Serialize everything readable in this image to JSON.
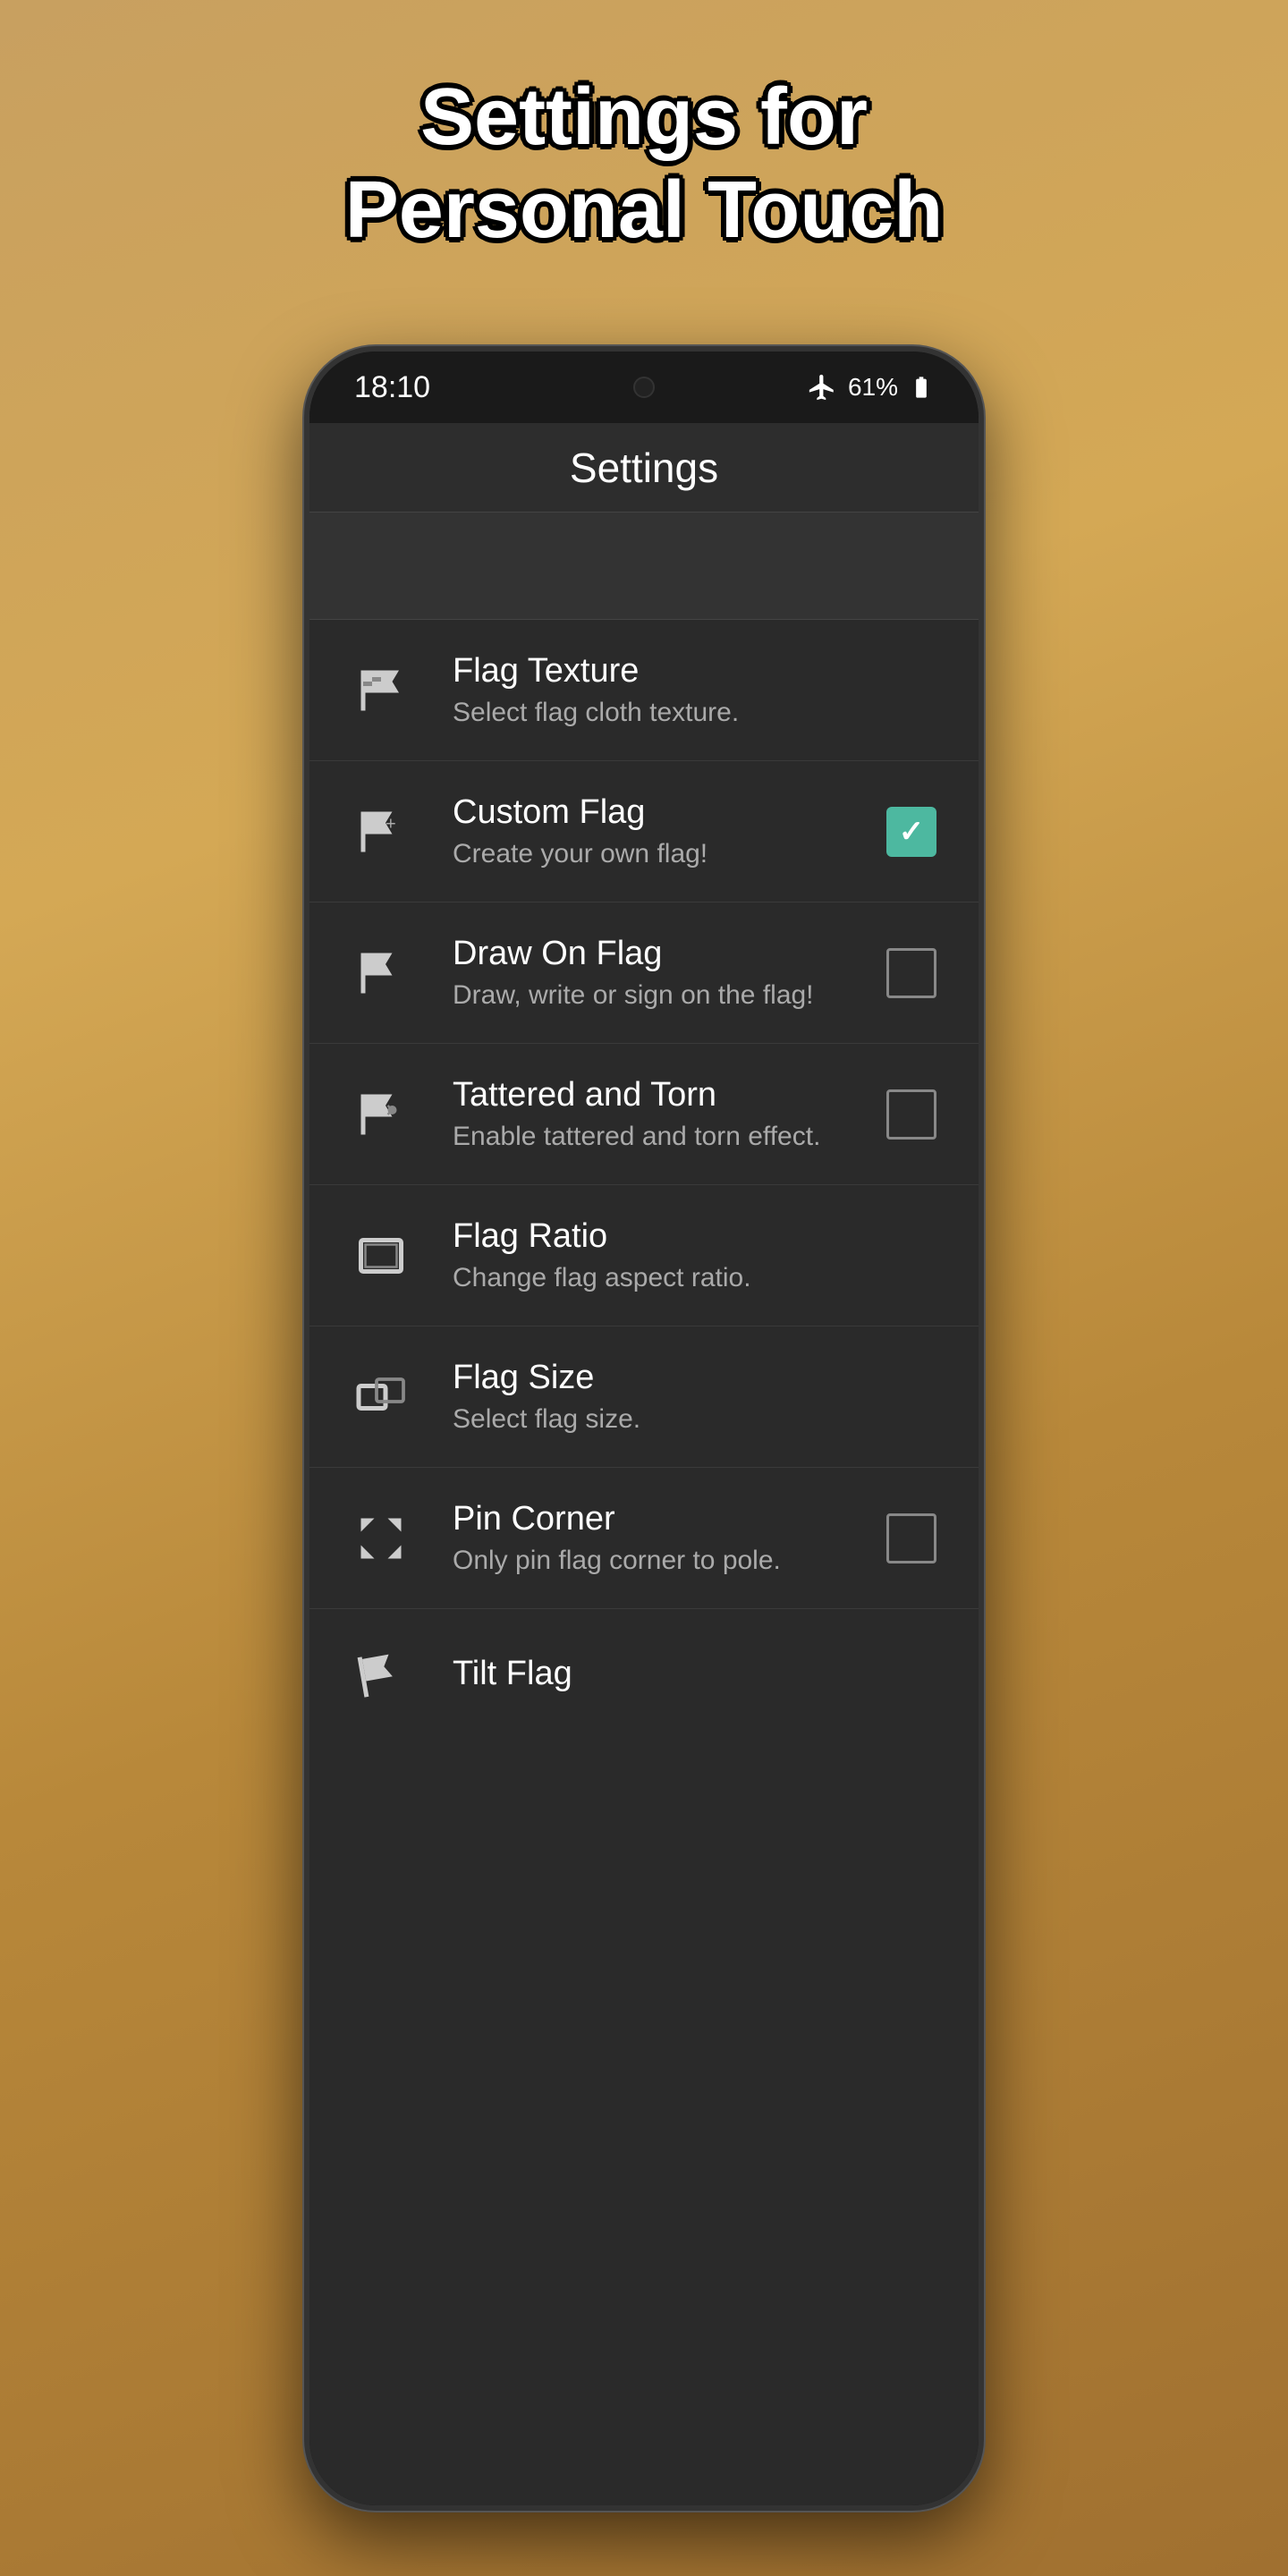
{
  "page": {
    "title_line1": "Settings for",
    "title_line2": "Personal Touch"
  },
  "status_bar": {
    "time": "18:10",
    "battery": "61%",
    "airplane_mode": true
  },
  "app_bar": {
    "title": "Settings"
  },
  "settings": {
    "items": [
      {
        "id": "flag-texture",
        "title": "Flag Texture",
        "subtitle": "Select flag cloth texture.",
        "has_checkbox": false,
        "checked": false,
        "icon": "flag-texture-icon"
      },
      {
        "id": "custom-flag",
        "title": "Custom Flag",
        "subtitle": "Create your own flag!",
        "has_checkbox": true,
        "checked": true,
        "icon": "custom-flag-icon"
      },
      {
        "id": "draw-on-flag",
        "title": "Draw On Flag",
        "subtitle": "Draw, write or sign on the flag!",
        "has_checkbox": true,
        "checked": false,
        "icon": "draw-flag-icon"
      },
      {
        "id": "tattered-torn",
        "title": "Tattered and Torn",
        "subtitle": "Enable tattered and torn effect.",
        "has_checkbox": true,
        "checked": false,
        "icon": "tattered-icon"
      },
      {
        "id": "flag-ratio",
        "title": "Flag Ratio",
        "subtitle": "Change flag aspect ratio.",
        "has_checkbox": false,
        "checked": false,
        "icon": "flag-ratio-icon"
      },
      {
        "id": "flag-size",
        "title": "Flag Size",
        "subtitle": "Select flag size.",
        "has_checkbox": false,
        "checked": false,
        "icon": "flag-size-icon"
      },
      {
        "id": "pin-corner",
        "title": "Pin Corner",
        "subtitle": "Only pin flag corner to pole.",
        "has_checkbox": true,
        "checked": false,
        "icon": "pin-corner-icon"
      },
      {
        "id": "tilt-flag",
        "title": "Tilt Flag",
        "subtitle": "",
        "has_checkbox": false,
        "checked": false,
        "icon": "tilt-flag-icon"
      }
    ]
  }
}
